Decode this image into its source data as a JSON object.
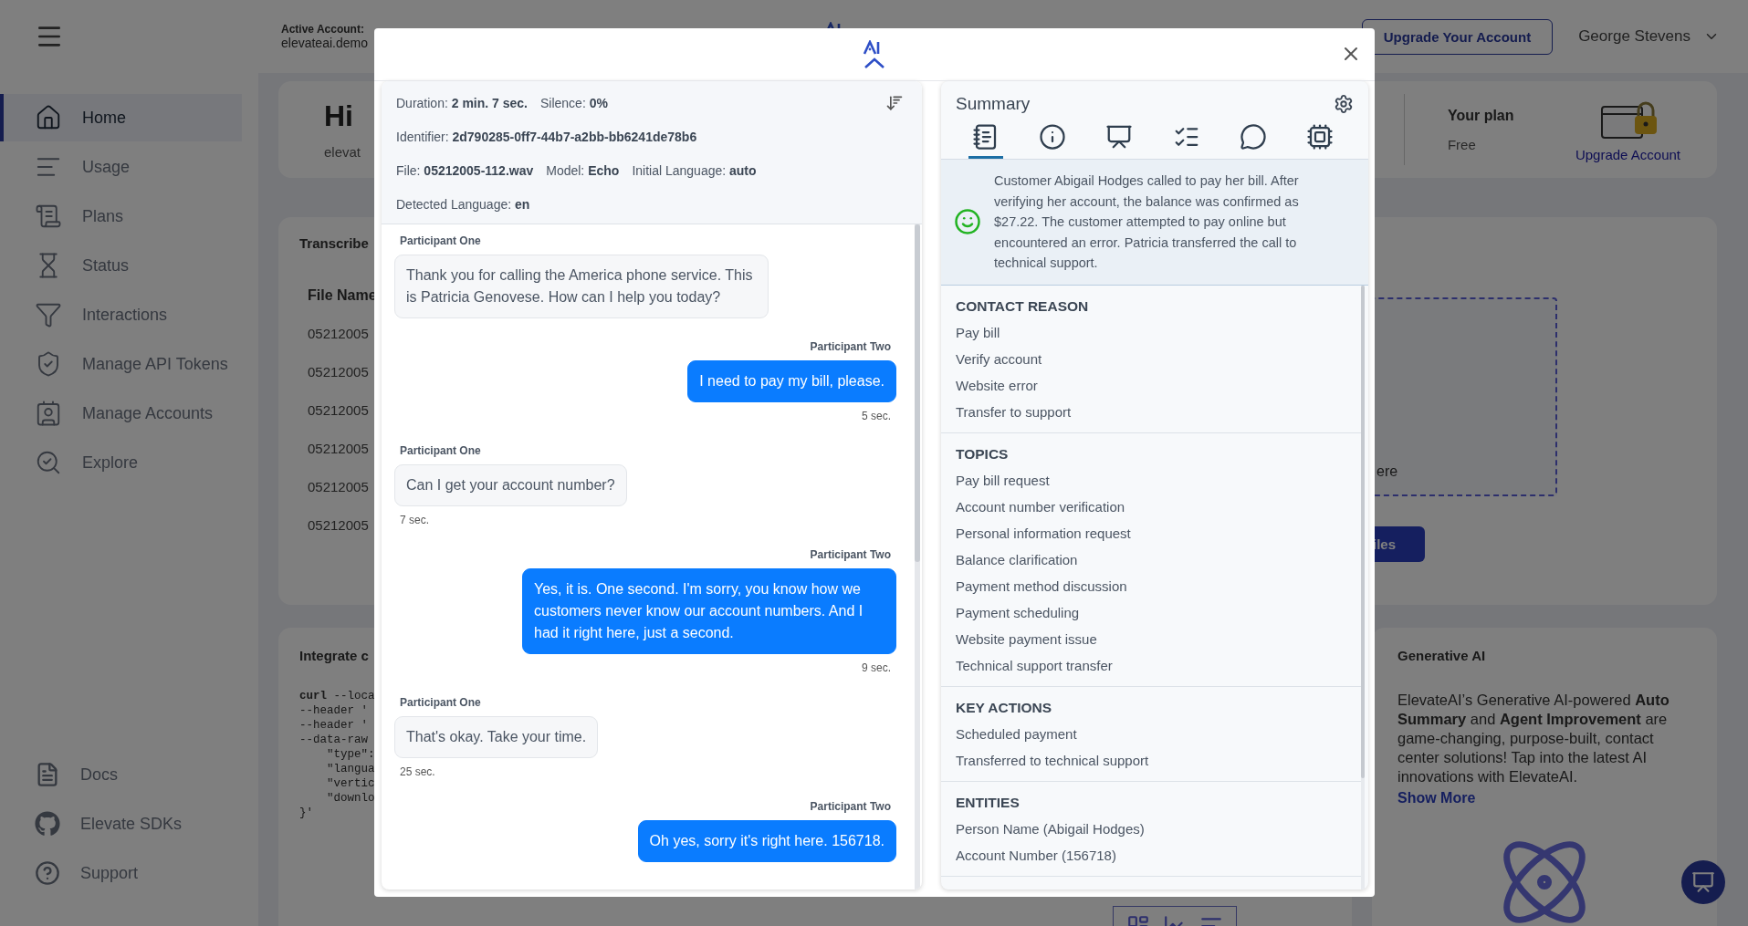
{
  "header": {
    "account_label": "Active Account:",
    "account_value": "elevateai.demo",
    "upgrade_button": "Upgrade Your Account",
    "user_name": "George Stevens"
  },
  "sidebar": {
    "items": [
      {
        "label": "Home",
        "selected": true
      },
      {
        "label": "Usage",
        "selected": false
      },
      {
        "label": "Plans",
        "selected": false
      },
      {
        "label": "Status",
        "selected": false
      },
      {
        "label": "Interactions",
        "selected": false
      },
      {
        "label": "Manage API Tokens",
        "selected": false
      },
      {
        "label": "Manage Accounts",
        "selected": false
      },
      {
        "label": "Explore",
        "selected": false
      }
    ],
    "footer_items": [
      "Docs",
      "Elevate SDKs",
      "Support"
    ]
  },
  "welcome": {
    "greeting": "Hi",
    "subtitle": "elevat",
    "plan_label": "Your plan",
    "plan_value": "Free",
    "upgrade_link": "Upgrade Account"
  },
  "transcribe": {
    "title": "Transcribe",
    "column_header": "File Name",
    "rows": [
      "05212005",
      "05212005",
      "05212005",
      "05212005",
      "05212005",
      "05212005"
    ],
    "dropzone_text": "ere",
    "button": "iles"
  },
  "integrate": {
    "title": "Integrate c",
    "code_lines": [
      "**curl** --loca",
      "--header '",
      "--header '",
      "--data-raw",
      "    \"type\":",
      "    \"langua",
      "    \"vertic",
      "    \"downlo",
      "}'"
    ]
  },
  "generative": {
    "title": "Generative AI",
    "text": "ElevateAI’s Generative AI-powered **Auto Summary** and **Agent Improvement** are game-changing, purpose-built, contact center solutions! Tap into the latest AI innovations with ElevateAI.",
    "link": "Show More"
  },
  "modal": {
    "meta": [
      [
        "Duration: **2 min. 7 sec.**",
        "Silence: **0%**"
      ],
      [
        "Identifier: **2d790285-0ff7-44b7-a2bb-bb6241de78b6**"
      ],
      [
        "File: **05212005-112.wav**",
        "Model: **Echo**",
        "Initial Language: **auto**"
      ],
      [
        "Detected Language: **en**"
      ]
    ],
    "messages": [
      {
        "kind": "incoming",
        "speaker": "Participant One",
        "text": "Thank you for calling the America phone service. This is Patricia Genovese. How can I help you today?"
      },
      {
        "kind": "outgoing",
        "speaker": "Participant Two",
        "text": "I need to pay my bill, please.",
        "time": "5 sec."
      },
      {
        "kind": "incoming",
        "speaker": "Participant One",
        "text": "Can I get your account number?",
        "time": "7 sec."
      },
      {
        "kind": "outgoing",
        "speaker": "Participant Two",
        "text": "Yes, it is. One second. I'm sorry, you know how we customers never know our account numbers. And I had it right here, just a second.",
        "time": "9 sec."
      },
      {
        "kind": "incoming",
        "speaker": "Participant One",
        "text": "That's okay. Take your time.",
        "time": "25 sec."
      },
      {
        "kind": "outgoing",
        "speaker": "Participant Two",
        "text": "Oh yes, sorry it's right here. 156718."
      }
    ],
    "summary": {
      "title": "Summary",
      "tabs": [
        {
          "selected": true
        },
        {
          "selected": false
        },
        {
          "selected": false
        },
        {
          "selected": false
        },
        {
          "selected": false
        },
        {
          "selected": false
        }
      ],
      "text": "Customer Abigail Hodges called to pay her bill. After verifying her account, the balance was confirmed as $27.22. The customer attempted to pay online but encountered an error. Patricia transferred the call to technical support.",
      "sections": [
        {
          "heading": "CONTACT REASON",
          "items": [
            "Pay bill",
            "Verify account",
            "Website error",
            "Transfer to support"
          ]
        },
        {
          "heading": "TOPICS",
          "items": [
            "Pay bill request",
            "Account number verification",
            "Personal information request",
            "Balance clarification",
            "Payment method discussion",
            "Payment scheduling",
            "Website payment issue",
            "Technical support transfer"
          ]
        },
        {
          "heading": "KEY ACTIONS",
          "items": [
            "Scheduled payment",
            "Transferred to technical support"
          ]
        },
        {
          "heading": "ENTITIES",
          "items": [
            "Person Name (Abigail Hodges)",
            "Account Number (156718)"
          ]
        }
      ]
    }
  }
}
